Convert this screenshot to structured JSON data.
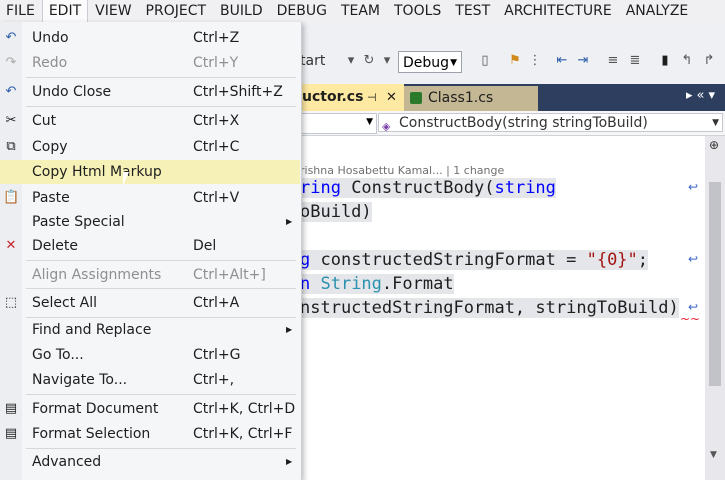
{
  "menubar": [
    "FILE",
    "EDIT",
    "VIEW",
    "PROJECT",
    "BUILD",
    "DEBUG",
    "TEAM",
    "TOOLS",
    "TEST",
    "ARCHITECTURE",
    "ANALYZE"
  ],
  "toolbar": {
    "start_text": "tart",
    "config": "Debug"
  },
  "tabs": {
    "active": "uctor.cs",
    "second": "Class1.cs"
  },
  "navbar": {
    "member": "ConstructBody(string stringToBuild)"
  },
  "editor": {
    "codelens": "rishna Hosabettu Kamal... | 1 change",
    "line1a": "ring ",
    "line1b": "ConstructBody(",
    "line1c": "string",
    "line2": "oBuild)",
    "line3a": "g ",
    "line3b": "constructedStringFormat = ",
    "line3c": "\"{0}\"",
    "line3d": ";",
    "line4a": "n ",
    "line4b": "String",
    "line4c": ".Format",
    "line5": "nstructedStringFormat, stringToBuild)"
  },
  "edit_menu": {
    "undo": "Undo",
    "undo_sc": "Ctrl+Z",
    "redo": "Redo",
    "redo_sc": "Ctrl+Y",
    "undo_close": "Undo Close",
    "undo_close_sc": "Ctrl+Shift+Z",
    "cut": "Cut",
    "cut_sc": "Ctrl+X",
    "copy": "Copy",
    "copy_sc": "Ctrl+C",
    "copy_html": "Copy Html Markup",
    "paste": "Paste",
    "paste_sc": "Ctrl+V",
    "paste_special": "Paste Special",
    "delete": "Delete",
    "delete_sc": "Del",
    "align": "Align Assignments",
    "align_sc": "Ctrl+Alt+]",
    "select_all": "Select All",
    "select_all_sc": "Ctrl+A",
    "find_replace": "Find and Replace",
    "go_to": "Go To...",
    "go_to_sc": "Ctrl+G",
    "navigate_to": "Navigate To...",
    "navigate_to_sc": "Ctrl+,",
    "format_doc": "Format Document",
    "format_doc_sc": "Ctrl+K, Ctrl+D",
    "format_sel": "Format Selection",
    "format_sel_sc": "Ctrl+K, Ctrl+F",
    "advanced": "Advanced"
  }
}
